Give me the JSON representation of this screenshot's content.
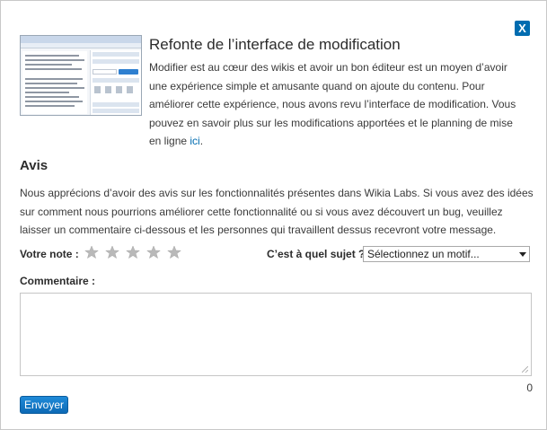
{
  "dialog": {
    "close_label": "X"
  },
  "intro": {
    "title": "Refonte de l’interface de modification",
    "text": "Modifier est au cœur des wikis et avoir un bon éditeur est un moyen d’avoir une expérience simple et amusante quand on ajoute du contenu. Pour améliorer cette expérience, nous avons revu l’interface de modification. Vous pouvez en savoir plus sur les modifications apportées et le planning de mise en ligne ",
    "link_text": "ici",
    "after_link": "."
  },
  "feedback": {
    "title": "Avis",
    "text": "Nous apprécions d’avoir des avis sur les fonctionnalités présentes dans Wikia Labs. Si vous avez des idées sur comment nous pourrions améliorer cette fonctionnalité ou si vous avez découvert un bug, veuillez laisser un commentaire ci-dessous et les personnes qui travaillent dessus recevront votre message."
  },
  "form": {
    "rating_label": "Votre note :",
    "rating": 0,
    "rating_max": 5,
    "subject_label": "C’est à quel sujet ?",
    "subject_selected": "Sélectionnez un motif...",
    "comment_label": "Commentaire :",
    "comment_value": "",
    "char_count": "0",
    "submit_label": "Envoyer"
  },
  "colors": {
    "accent": "#006cb0",
    "star_empty": "#b9b9b9"
  },
  "icons": {
    "close": "close-icon",
    "star": "star-icon",
    "dropdown": "chevron-down-icon",
    "resize": "resize-grip-icon"
  }
}
